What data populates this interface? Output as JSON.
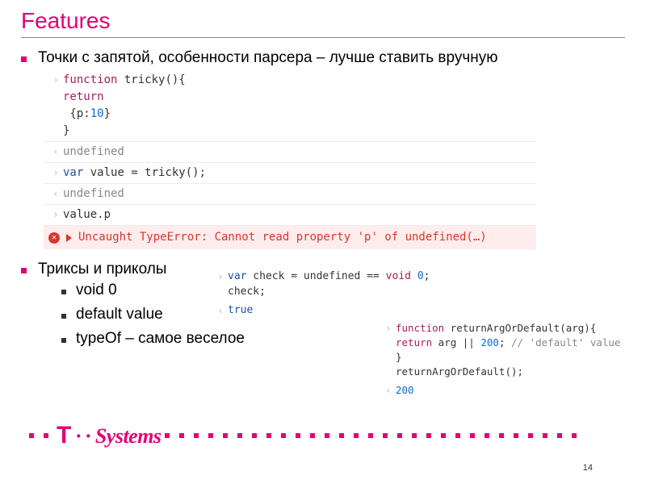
{
  "title": "Features",
  "bullets": {
    "b1": "Точки с запятой, особенности парсера – лучше ставить вручную",
    "b2": "Триксы и приколы",
    "sub1": "void 0",
    "sub2": "default value",
    "sub3": "typeOf – самое веселое"
  },
  "console1": {
    "l1a": "function",
    "l1b": " tricky(){",
    "l2a": "return",
    "l3a": " {p:",
    "l3b": "10",
    "l3c": "}",
    "l4": "}",
    "r1": "undefined",
    "l5a": "var",
    "l5b": " value = tricky();",
    "r2": "undefined",
    "l6": "value.p",
    "err": "Uncaught TypeError: Cannot read property 'p' of undefined(…)"
  },
  "console2": {
    "l1a": "var",
    "l1b": " check = undefined == ",
    "l1c": "void",
    "l1d": " ",
    "l1e": "0",
    "l1f": ";",
    "l2": "check;",
    "r1": "true"
  },
  "console3": {
    "l1a": "function",
    "l1b": " returnArgOrDefault(arg){",
    "l2a": "return",
    "l2b": " arg || ",
    "l2c": "200",
    "l2d": "; ",
    "l2e": "// 'default' value",
    "l3": "}",
    "l4": "returnArgOrDefault();",
    "r1": "200"
  },
  "logo": {
    "t": "T",
    "rest": "Systems"
  },
  "page": "14",
  "glyphs": {
    "in": "›",
    "out": "‹",
    "x": "✕"
  }
}
